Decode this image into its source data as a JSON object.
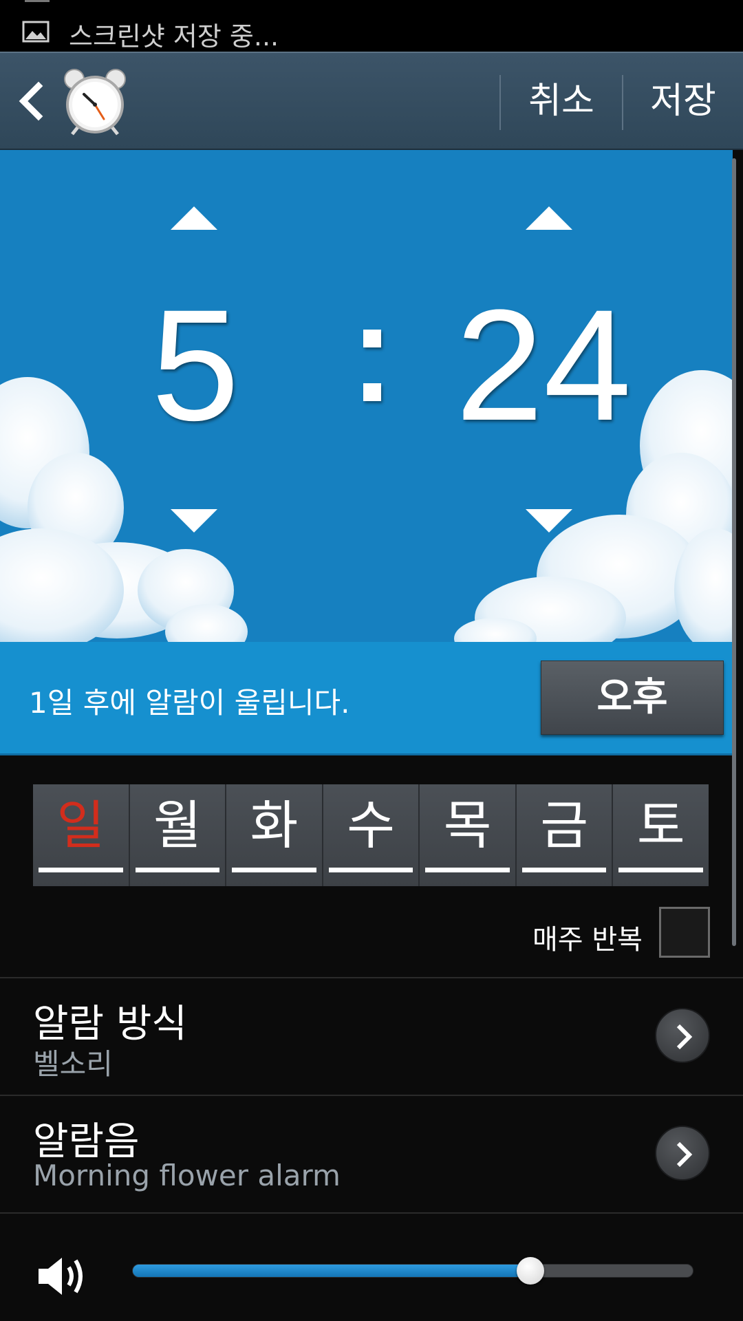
{
  "status_bar": {
    "notification_text": "스크린샷 저장 중..."
  },
  "action_bar": {
    "cancel_label": "취소",
    "save_label": "저장"
  },
  "time_picker": {
    "hour": "5",
    "minute": "24"
  },
  "info": {
    "message": "1일 후에 알람이 울립니다.",
    "ampm_label": "오후"
  },
  "days": [
    {
      "label": "일",
      "color": "#d22d1c"
    },
    {
      "label": "월"
    },
    {
      "label": "화"
    },
    {
      "label": "수"
    },
    {
      "label": "목"
    },
    {
      "label": "금"
    },
    {
      "label": "토"
    }
  ],
  "repeat": {
    "label": "매주 반복",
    "checked": false
  },
  "settings": [
    {
      "title": "알람 방식",
      "value": "벨소리"
    },
    {
      "title": "알람음",
      "value": "Morning flower alarm"
    }
  ],
  "volume": {
    "level": 0.71
  },
  "colors": {
    "sky": "#1680c0",
    "info_bar": "#1690cf",
    "accent_blue": "#1a8ad4",
    "sunday_red": "#d22d1c"
  }
}
